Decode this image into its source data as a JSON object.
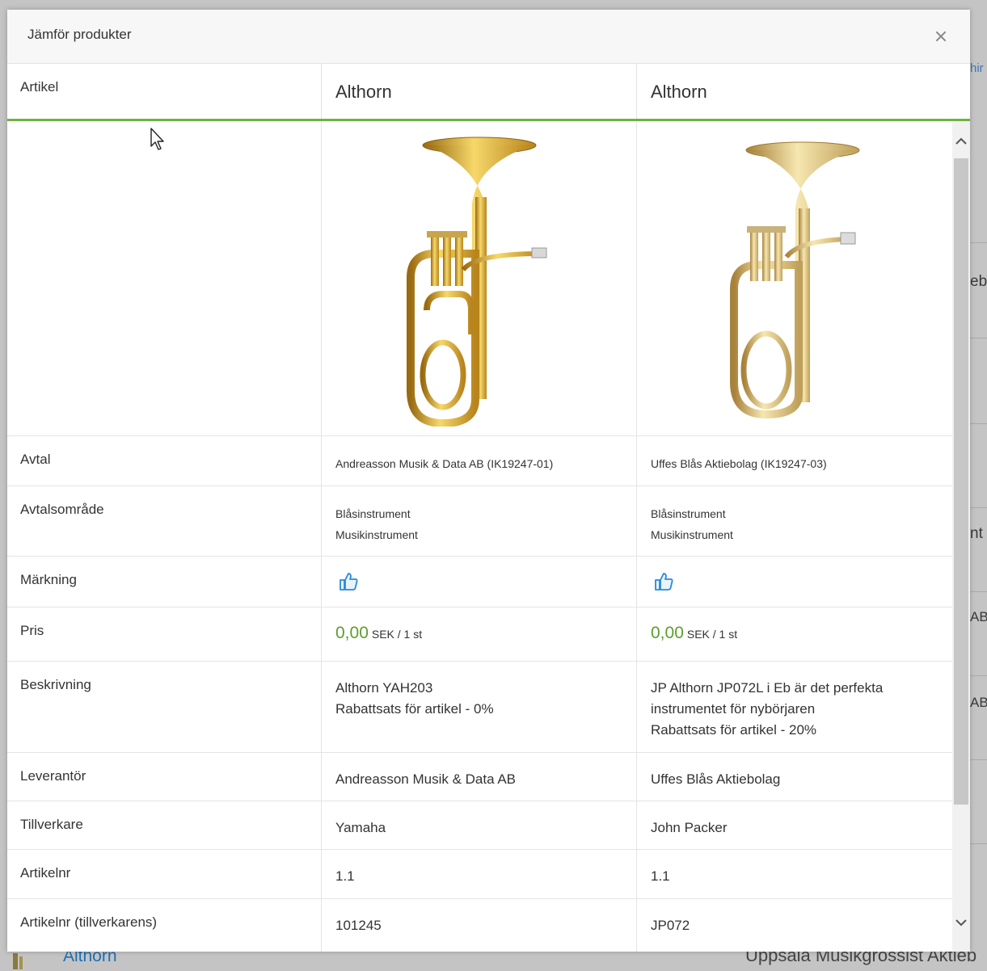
{
  "background": {
    "fragments": [
      "hir",
      "eb",
      "nt",
      "AB",
      "AB"
    ],
    "bottom_link": "Althorn",
    "bottom_right": "Uppsala Musikgrossist Aktieb"
  },
  "modal": {
    "title": "Jämför produkter",
    "close_icon": "close-icon",
    "header": {
      "label": "Artikel",
      "products": [
        "Althorn",
        "Althorn"
      ]
    },
    "rows": [
      {
        "label": "Avtal",
        "values": [
          "Andreasson Musik & Data AB (IK19247-01)",
          "Uffes Blås Aktiebolag (IK19247-03)"
        ]
      },
      {
        "label": "Avtalsområde",
        "values": [
          [
            "Blåsinstrument",
            "Musikinstrument"
          ],
          [
            "Blåsinstrument",
            "Musikinstrument"
          ]
        ]
      },
      {
        "label": "Märkning",
        "icons": [
          "thumbs-up-icon",
          "thumbs-up-icon"
        ]
      },
      {
        "label": "Pris",
        "prices": [
          {
            "amount": "0,00",
            "unit": "SEK / 1 st"
          },
          {
            "amount": "0,00",
            "unit": "SEK / 1 st"
          }
        ]
      },
      {
        "label": "Beskrivning",
        "values": [
          [
            "Althorn YAH203",
            "Rabattsats för artikel - 0%"
          ],
          [
            "JP Althorn JP072L i Eb är det perfekta",
            "instrumentet för nybörjaren",
            "Rabattsats för artikel - 20%"
          ]
        ]
      },
      {
        "label": "Leverantör",
        "values": [
          "Andreasson Musik & Data AB",
          "Uffes Blås Aktiebolag"
        ]
      },
      {
        "label": "Tillverkare",
        "values": [
          "Yamaha",
          "John Packer"
        ]
      },
      {
        "label": "Artikelnr",
        "values": [
          "1.1",
          "1.1"
        ]
      },
      {
        "label": "Artikelnr (tillverkarens)",
        "values": [
          "101245",
          "JP072"
        ]
      }
    ]
  },
  "colors": {
    "accent_green": "#6db33f",
    "price_green": "#5a9e2c",
    "thumb_blue": "#2a8ad6"
  }
}
